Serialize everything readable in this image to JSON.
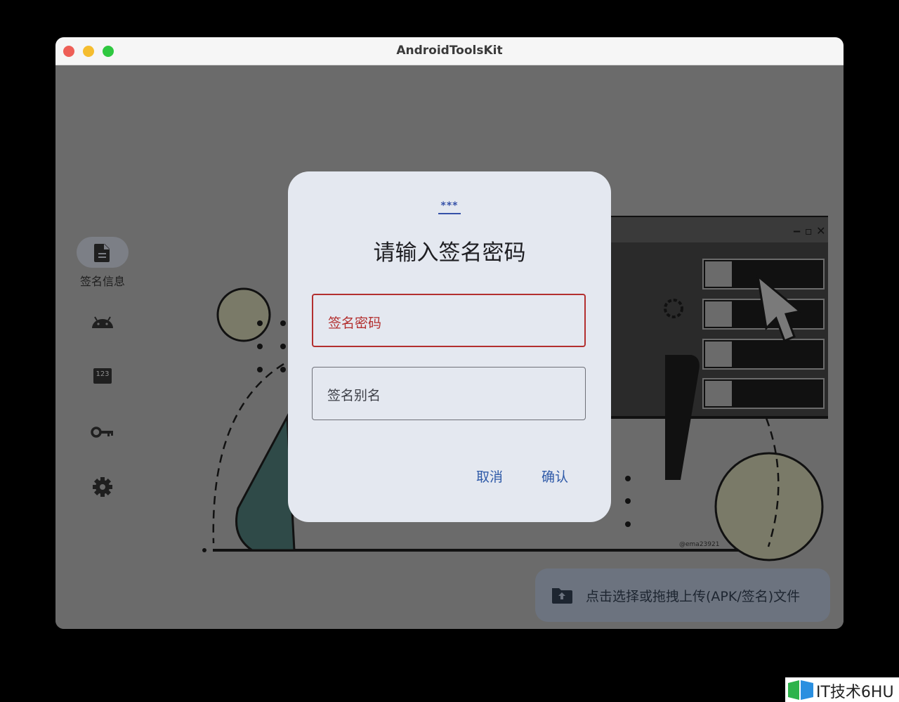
{
  "window": {
    "title": "AndroidToolsKit"
  },
  "sidebar": {
    "items": [
      {
        "icon": "document-icon",
        "label": "签名信息",
        "active": true
      },
      {
        "icon": "android-icon"
      },
      {
        "icon": "numeric-123-icon",
        "text": "123"
      },
      {
        "icon": "key-icon"
      },
      {
        "icon": "gear-icon"
      }
    ]
  },
  "illustration": {
    "credit": "@ema23921"
  },
  "dialog": {
    "icon_text": "***",
    "title": "请输入签名密码",
    "password_label": "签名密码",
    "alias_label": "签名别名",
    "cancel_label": "取消",
    "confirm_label": "确认"
  },
  "upload": {
    "icon": "folder-upload-icon",
    "label": "点击选择或拖拽上传(APK/签名)文件"
  },
  "watermark": {
    "text": "IT技术6HU"
  },
  "colors": {
    "accent": "#2f5aa8",
    "error": "#b32f2f",
    "dialog_bg": "#e4e8f0",
    "scrim": "#6b6b6b"
  }
}
